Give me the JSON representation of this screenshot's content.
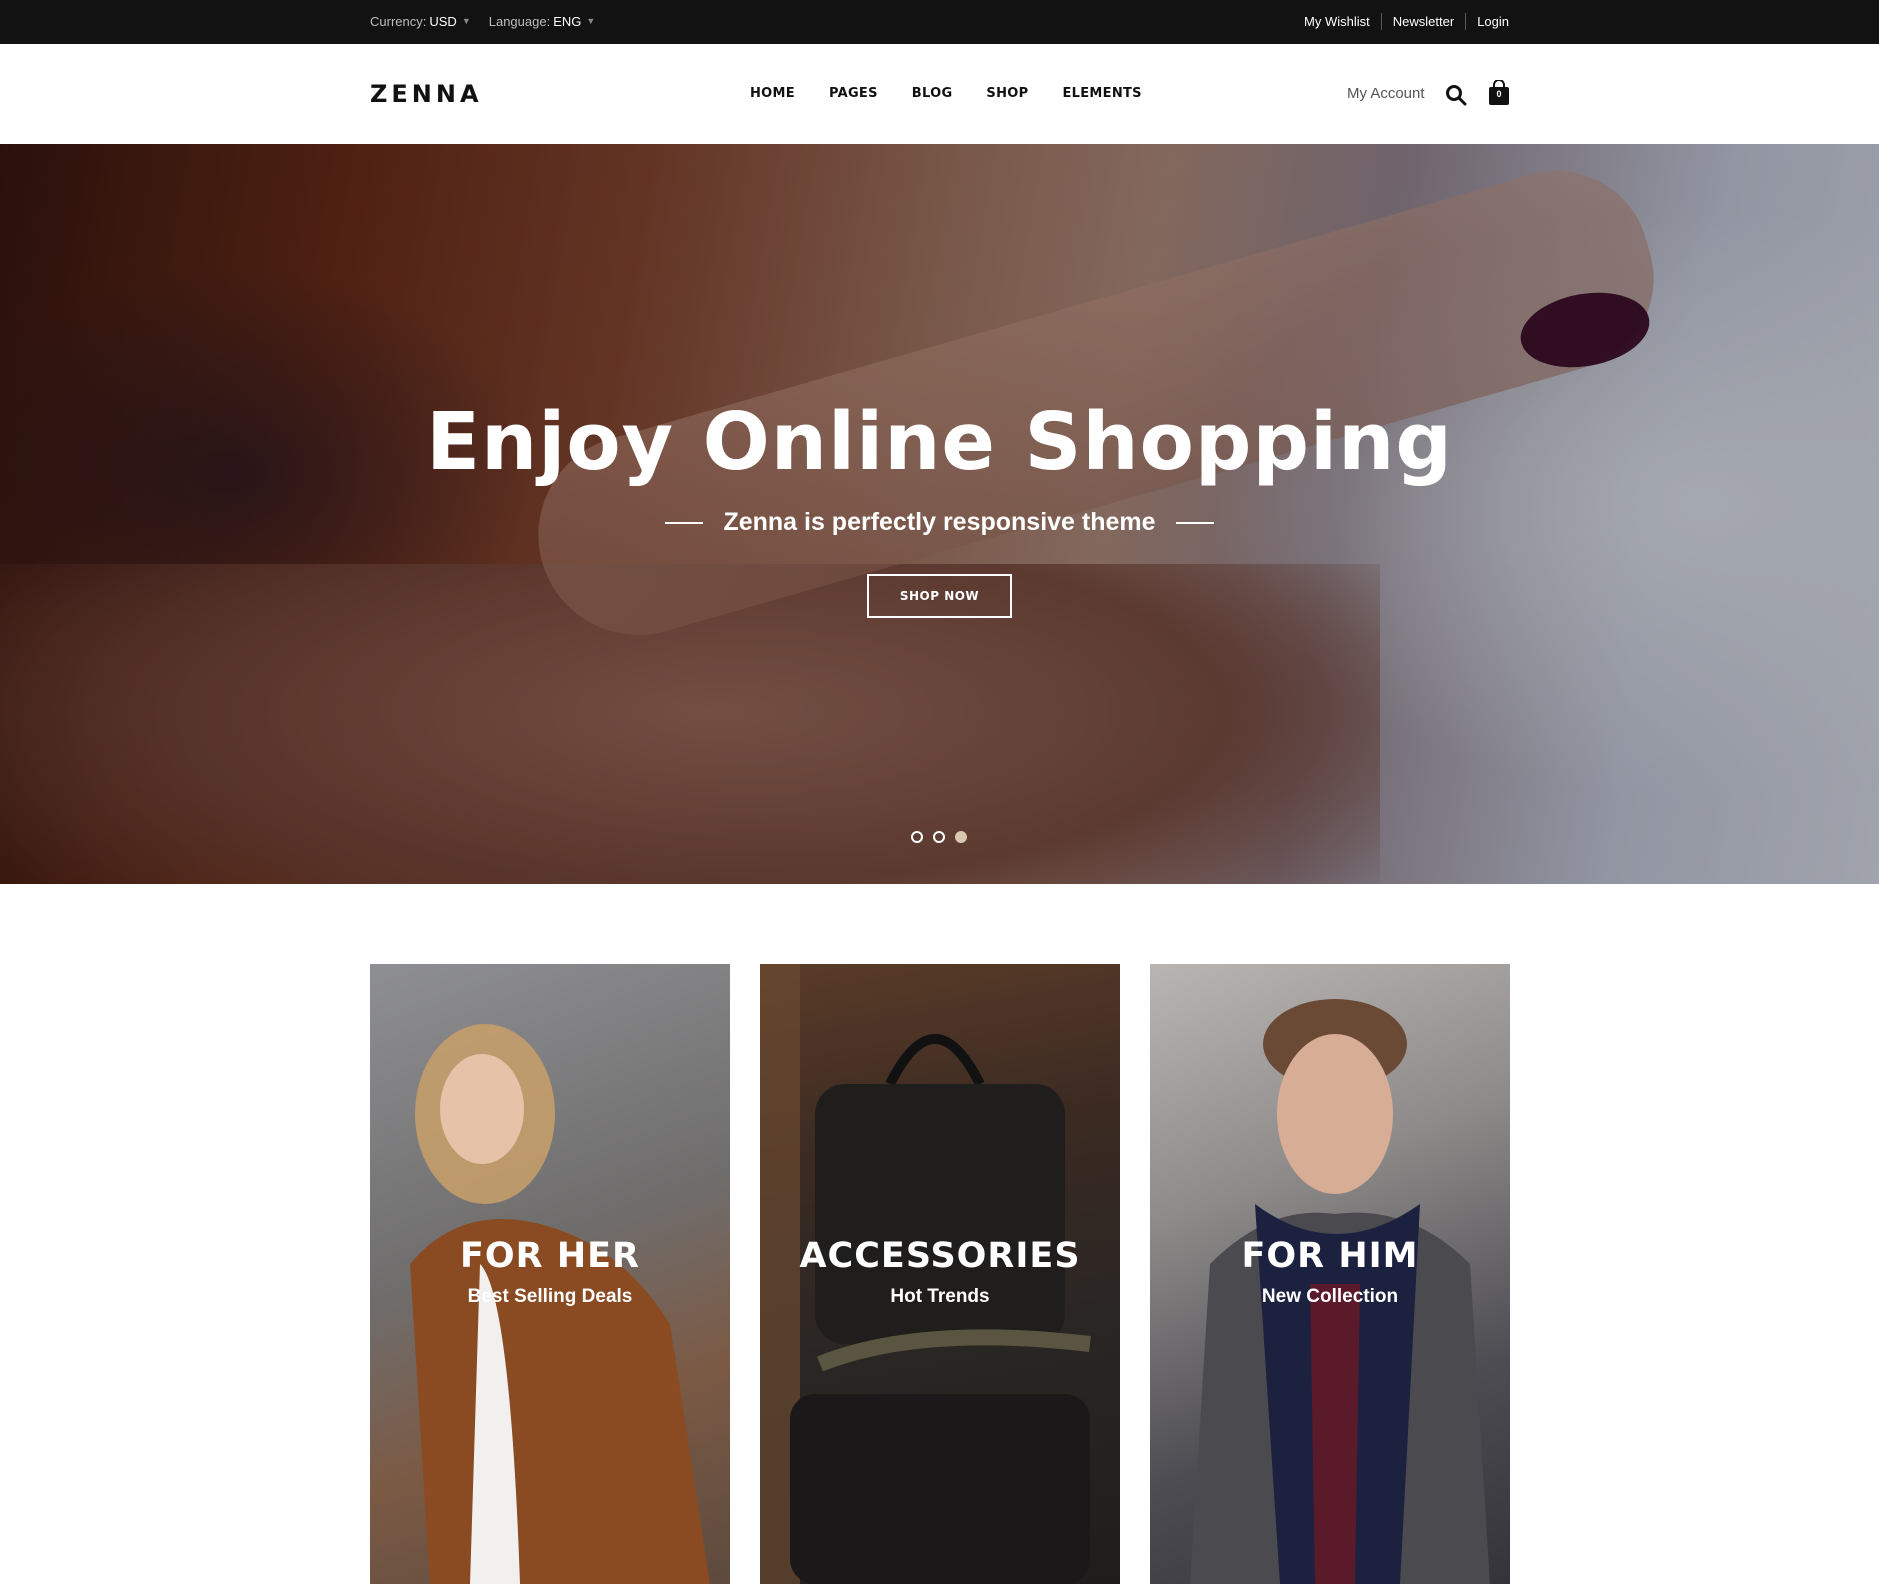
{
  "topbar": {
    "currency_label": "Currency:",
    "currency_value": "USD",
    "language_label": "Language:",
    "language_value": "ENG",
    "links": [
      "My Wishlist",
      "Newsletter",
      "Login"
    ]
  },
  "header": {
    "logo": "ZENNA",
    "nav": [
      "HOME",
      "PAGES",
      "BLOG",
      "SHOP",
      "ELEMENTS"
    ],
    "account_label": "My Account",
    "cart_count": "0"
  },
  "hero": {
    "title": "Enjoy Online Shopping",
    "subtitle": "Zenna is perfectly responsive theme",
    "button": "SHOP NOW",
    "slides": 3,
    "active_slide": 3
  },
  "categories": [
    {
      "title": "FOR HER",
      "tagline": "Best Selling Deals"
    },
    {
      "title": "ACCESSORIES",
      "tagline": "Hot Trends"
    },
    {
      "title": "FOR HIM",
      "tagline": "New Collection"
    }
  ],
  "colors": {
    "topbar_bg": "#121212",
    "active_dot": "#d9c7ae"
  }
}
